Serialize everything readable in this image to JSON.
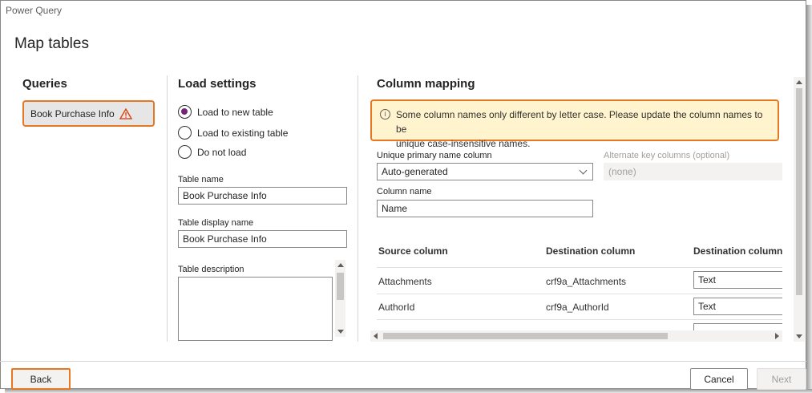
{
  "window": {
    "title": "Power Query"
  },
  "dialog": {
    "title": "Map tables"
  },
  "queries": {
    "header": "Queries",
    "items": [
      {
        "label": "Book Purchase Info",
        "icon": "warning-icon"
      }
    ]
  },
  "load_settings": {
    "header": "Load settings",
    "options": [
      {
        "label": "Load to new table",
        "checked": true
      },
      {
        "label": "Load to existing table",
        "checked": false
      },
      {
        "label": "Do not load",
        "checked": false
      }
    ],
    "table_name_label": "Table name",
    "table_name_value": "Book Purchase Info",
    "table_display_name_label": "Table display name",
    "table_display_name_value": "Book Purchase Info",
    "table_description_label": "Table description"
  },
  "column_mapping": {
    "header": "Column mapping",
    "warning_line1": "Some column names only different by letter case. Please update the column names to be",
    "warning_line2": "unique case-insensitive names.",
    "unique_primary_label": "Unique primary name column",
    "unique_primary_value": "Auto-generated",
    "alternate_key_label": "Alternate key columns (optional)",
    "alternate_key_value": "(none)",
    "column_name_label": "Column name",
    "column_name_value": "Name",
    "table": {
      "headers": [
        "Source column",
        "Destination column",
        "Destination column t"
      ],
      "rows": [
        {
          "source": "Attachments",
          "destination": "crf9a_Attachments",
          "type": "Text"
        },
        {
          "source": "AuthorId",
          "destination": "crf9a_AuthorId",
          "type": "Text"
        }
      ]
    }
  },
  "footer": {
    "back": "Back",
    "cancel": "Cancel",
    "next": "Next"
  },
  "colors": {
    "accent": "#742774",
    "highlight": "#e87722",
    "warning_bg": "#fff4ce"
  }
}
